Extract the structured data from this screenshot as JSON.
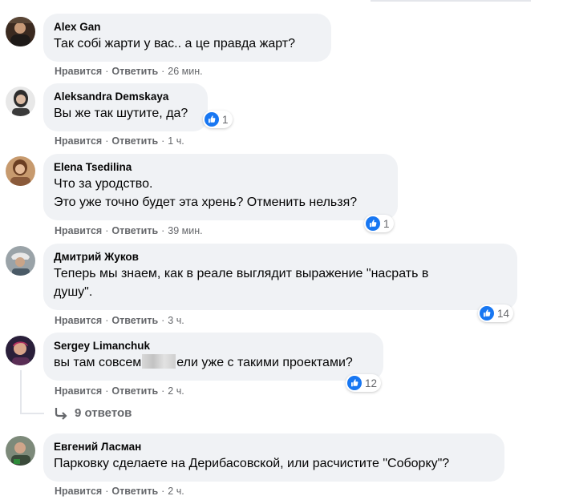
{
  "actions": {
    "like": "Нравится",
    "reply": "Ответить",
    "dot": "·"
  },
  "comments": [
    {
      "author": "Alex Gan",
      "lines": [
        "Так собі жарти у вас.. а це правда жарт?"
      ],
      "time": "26 мин."
    },
    {
      "author": "Aleksandra Demskaya",
      "lines": [
        "Вы же так шутите, да?"
      ],
      "time": "1 ч.",
      "reactions": "1"
    },
    {
      "author": "Elena Tsedilina",
      "lines": [
        "Что за уродство.",
        "Это уже точно будет эта хрень? Отменить нельзя?"
      ],
      "time": "39 мин.",
      "reactions": "1"
    },
    {
      "author": "Дмитрий Жуков",
      "lines": [
        "Теперь мы знаем, как в реале выглядит выражение \"насрать в",
        "душу\"."
      ],
      "time": "3 ч.",
      "reactions": "14"
    },
    {
      "author": "Sergey Limanchuk",
      "text_before": "вы там совсем",
      "text_after": "ели уже с такими проектами?",
      "time": "2 ч.",
      "reactions": "12",
      "replies_label": "9 ответов"
    },
    {
      "author": "Евгений Ласман",
      "lines": [
        "Парковку сделаете на Дерибасовской, или расчистите \"Соборку\"?"
      ],
      "time": "2 ч."
    }
  ],
  "colors": {
    "bubble": "#f0f2f5",
    "meta": "#65676b",
    "like_blue": "#1877f2",
    "text": "#050505"
  },
  "icons": [
    "like-icon",
    "reply-arrow-icon",
    "avatar"
  ]
}
